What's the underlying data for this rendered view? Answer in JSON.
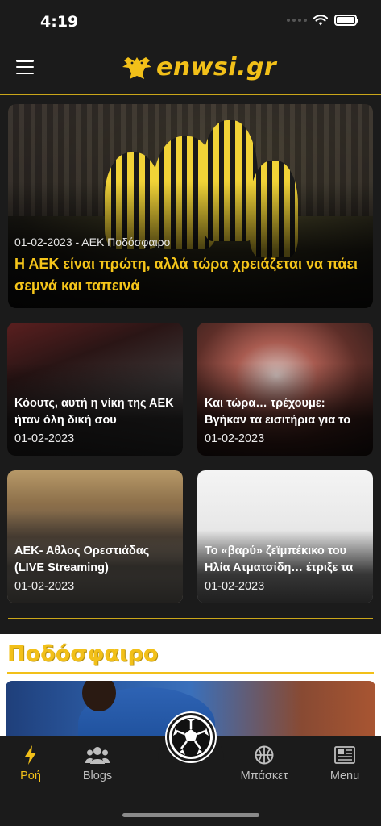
{
  "status_bar": {
    "time": "4:19"
  },
  "header": {
    "logo_text": "enwsi.gr"
  },
  "hero": {
    "meta": "01-02-2023 - ΑΕΚ Ποδόσφαιρο",
    "title": "Η ΑΕΚ είναι πρώτη, αλλά τώρα χρειάζεται να πάει σεμνά και ταπεινά"
  },
  "cards": [
    {
      "title": "Κόουτς, αυτή η νίκη της ΑΕΚ ήταν όλη δική σου",
      "date": "01-02-2023"
    },
    {
      "title": "Και τώρα… τρέχουμε: Βγήκαν τα εισιτήρια για το",
      "date": "01-02-2023"
    },
    {
      "title": "ΑΕΚ- Αθλος Ορεστιάδας (LIVE Streaming)",
      "date": "01-02-2023"
    },
    {
      "title": "Το «βαρύ» ζεϊμπέκικο του Ηλία Ατματσίδη… έτριξε τα",
      "date": "01-02-2023"
    }
  ],
  "section": {
    "title": "Ποδόσφαιρο"
  },
  "tabs": [
    {
      "label": "Ροή",
      "icon": "bolt-icon",
      "active": true
    },
    {
      "label": "Blogs",
      "icon": "users-icon",
      "active": false
    },
    {
      "label": "",
      "icon": "soccer-ball-icon",
      "active": false
    },
    {
      "label": "Μπάσκετ",
      "icon": "basketball-icon",
      "active": false
    },
    {
      "label": "Menu",
      "icon": "newspaper-icon",
      "active": false
    }
  ],
  "colors": {
    "accent": "#f2c019",
    "background": "#1b1b1b",
    "divider": "#caa61a"
  }
}
